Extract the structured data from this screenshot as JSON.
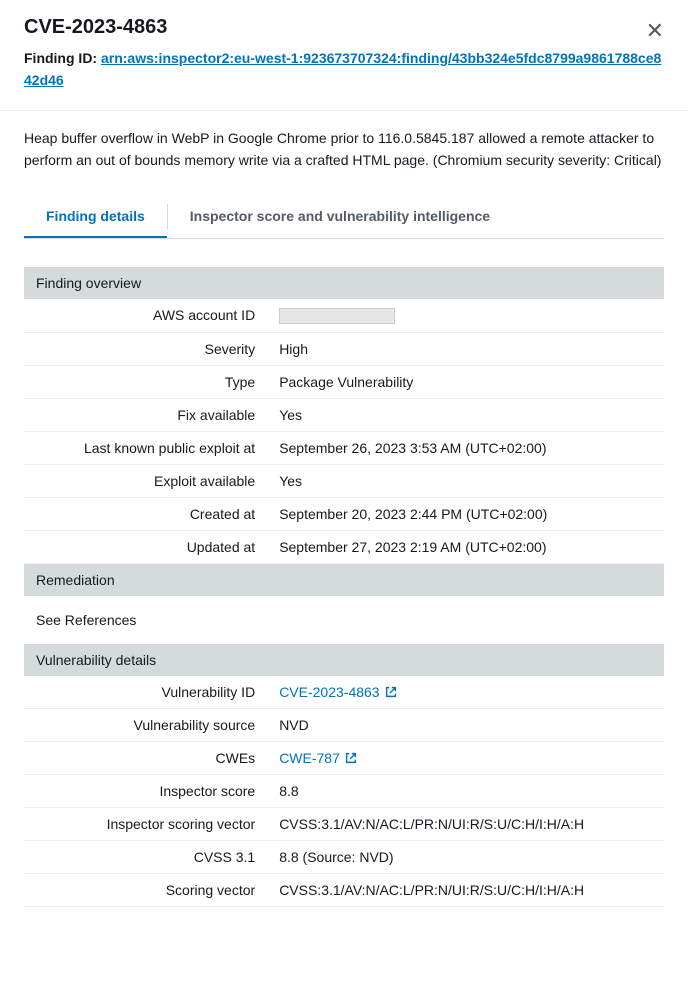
{
  "header": {
    "title": "CVE-2023-4863",
    "finding_id_label": "Finding ID: ",
    "finding_id_value": "arn:aws:inspector2:eu-west-1:923673707324:finding/43bb324e5fdc8799a9861788ce842d46"
  },
  "description": "Heap buffer overflow in WebP in Google Chrome prior to 116.0.5845.187 allowed a remote attacker to perform an out of bounds memory write via a crafted HTML page. (Chromium security severity: Critical)",
  "tabs": {
    "details": "Finding details",
    "score": "Inspector score and vulnerability intelligence"
  },
  "sections": {
    "overview": {
      "title": "Finding overview",
      "rows": {
        "aws_account_id": {
          "label": "AWS account ID",
          "value": ""
        },
        "severity": {
          "label": "Severity",
          "value": "High"
        },
        "type": {
          "label": "Type",
          "value": "Package Vulnerability"
        },
        "fix_available": {
          "label": "Fix available",
          "value": "Yes"
        },
        "last_exploit": {
          "label": "Last known public exploit at",
          "value": "September 26, 2023 3:53 AM (UTC+02:00)"
        },
        "exploit_available": {
          "label": "Exploit available",
          "value": "Yes"
        },
        "created_at": {
          "label": "Created at",
          "value": "September 20, 2023 2:44 PM (UTC+02:00)"
        },
        "updated_at": {
          "label": "Updated at",
          "value": "September 27, 2023 2:19 AM (UTC+02:00)"
        }
      }
    },
    "remediation": {
      "title": "Remediation",
      "body": "See References"
    },
    "vuln": {
      "title": "Vulnerability details",
      "rows": {
        "vuln_id": {
          "label": "Vulnerability ID",
          "value": "CVE-2023-4863"
        },
        "vuln_source": {
          "label": "Vulnerability source",
          "value": "NVD"
        },
        "cwes": {
          "label": "CWEs",
          "value": "CWE-787"
        },
        "inspector_score": {
          "label": "Inspector score",
          "value": "8.8"
        },
        "inspector_vector": {
          "label": "Inspector scoring vector",
          "value": "CVSS:3.1/AV:N/AC:L/PR:N/UI:R/S:U/C:H/I:H/A:H"
        },
        "cvss31": {
          "label": "CVSS 3.1",
          "value": "8.8 (Source: NVD)"
        },
        "scoring_vector": {
          "label": "Scoring vector",
          "value": "CVSS:3.1/AV:N/AC:L/PR:N/UI:R/S:U/C:H/I:H/A:H"
        }
      }
    }
  }
}
